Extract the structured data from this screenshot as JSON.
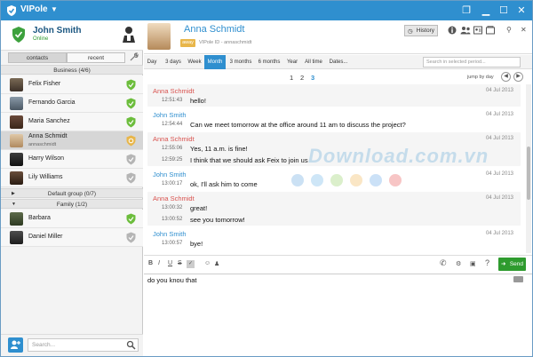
{
  "app": {
    "title": "VIPole"
  },
  "me": {
    "name": "John Smith",
    "status": "Online"
  },
  "tabs": {
    "contacts": "contacts",
    "recent": "recent"
  },
  "groups": {
    "business": "Business (4/6)",
    "default": "Default group (0/7)",
    "family": "Family (1/2)"
  },
  "contacts": [
    {
      "name": "Felix Fisher"
    },
    {
      "name": "Fernando Garcia"
    },
    {
      "name": "Maria Sanchez"
    },
    {
      "name": "Anna Schmidt",
      "id": "annaschmidt"
    },
    {
      "name": "Harry Wilson"
    },
    {
      "name": "Lily Williams"
    },
    {
      "name": "Barbara"
    },
    {
      "name": "Daniel Miller"
    }
  ],
  "left_search": {
    "placeholder": "Search..."
  },
  "chat_header": {
    "name": "Anna Schmidt",
    "status_badge": "away",
    "vipole_id": "VIPole ID - annaschmidt",
    "history_button": "History"
  },
  "periods": [
    "Day",
    "3 days",
    "Week",
    "Month",
    "3 months",
    "6 months",
    "Year",
    "All time",
    "Dates..."
  ],
  "period_search": {
    "placeholder": "Search in selected period..."
  },
  "pages": [
    "1",
    "2",
    "3"
  ],
  "jump_label": "jump by day",
  "messages": [
    {
      "sender": "Anna Schmidt",
      "date": "04 Jul 2013",
      "lines": [
        {
          "time": "12:51:43",
          "text": "hello!"
        }
      ]
    },
    {
      "sender": "John Smith",
      "date": "04 Jul 2013",
      "lines": [
        {
          "time": "12:54:44",
          "text": "Can we meet tomorrow at the office around 11 am to discuss the project?"
        }
      ]
    },
    {
      "sender": "Anna Schmidt",
      "date": "04 Jul 2013",
      "lines": [
        {
          "time": "12:55:06",
          "text": "Yes, 11 a.m. is fine!"
        },
        {
          "time": "12:59:25",
          "text": "I think that we should ask Feix to join us"
        }
      ]
    },
    {
      "sender": "John Smith",
      "date": "04 Jul 2013",
      "lines": [
        {
          "time": "13:00:17",
          "text": "ok, I'll ask him to come"
        }
      ]
    },
    {
      "sender": "Anna Schmidt",
      "date": "04 Jul 2013",
      "lines": [
        {
          "time": "13:00:32",
          "text": "great!"
        },
        {
          "time": "13:00:52",
          "text": "see you tomorrow!"
        }
      ]
    },
    {
      "sender": "John Smith",
      "date": "04 Jul 2013",
      "lines": [
        {
          "time": "13:00:57",
          "text": "bye!"
        }
      ]
    }
  ],
  "watermark": "Download.com.vn",
  "compose": {
    "value": "do you knou that",
    "send_label": "Send"
  },
  "format_buttons": [
    "B",
    "I",
    "U",
    "S"
  ],
  "colors": {
    "accent": "#2f8fcf",
    "online": "#2e9b2e",
    "anna": "#d9534f",
    "away": "#e8b64a"
  }
}
